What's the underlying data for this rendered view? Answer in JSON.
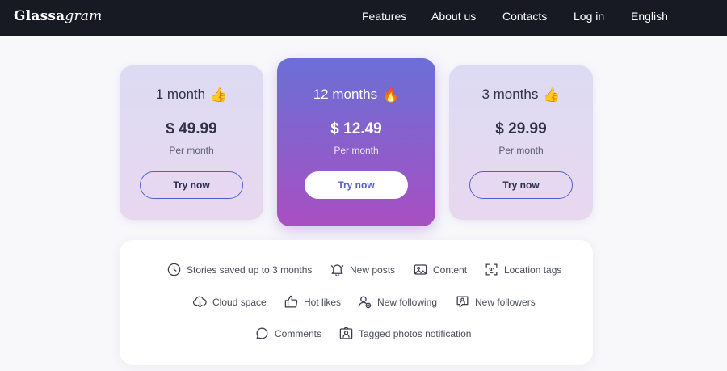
{
  "header": {
    "logo_main": "Glassa",
    "logo_accent": "gram",
    "nav": [
      "Features",
      "About us",
      "Contacts",
      "Log in",
      "English"
    ]
  },
  "plans": [
    {
      "title": "1 month",
      "emoji": "👍",
      "price": "$ 49.99",
      "period": "Per month",
      "cta": "Try now",
      "featured": false
    },
    {
      "title": "12 months",
      "emoji": "🔥",
      "price": "$ 12.49",
      "period": "Per month",
      "cta": "Try now",
      "featured": true
    },
    {
      "title": "3 months",
      "emoji": "👍",
      "price": "$ 29.99",
      "period": "Per month",
      "cta": "Try now",
      "featured": false
    }
  ],
  "features": [
    {
      "label": "Stories saved up to 3 months",
      "icon": "clock-icon"
    },
    {
      "label": "New posts",
      "icon": "bell-icon"
    },
    {
      "label": "Content",
      "icon": "image-icon"
    },
    {
      "label": "Location tags",
      "icon": "face-scan-icon"
    },
    {
      "label": "Cloud space",
      "icon": "cloud-download-icon"
    },
    {
      "label": "Hot likes",
      "icon": "thumbs-up-icon"
    },
    {
      "label": "New following",
      "icon": "user-add-icon"
    },
    {
      "label": "New followers",
      "icon": "user-message-icon"
    },
    {
      "label": "Comments",
      "icon": "comment-icon"
    },
    {
      "label": "Tagged photos notification",
      "icon": "tagged-photo-icon"
    }
  ],
  "colors": {
    "topbar": "#171a22",
    "accent": "#5360c8",
    "featured_top": "#6a70d6",
    "featured_bottom": "#a84fc2",
    "card_light_top": "#dcdbf3",
    "card_light_bottom": "#e8d8ef",
    "background": "#f8f8fb"
  }
}
